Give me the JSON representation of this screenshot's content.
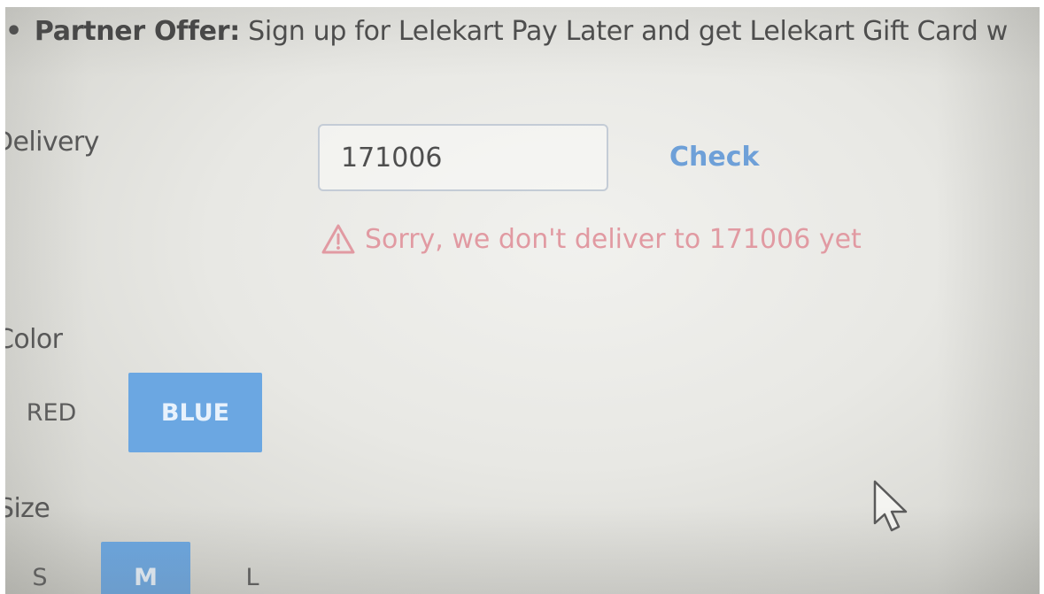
{
  "offer": {
    "bullet": "•",
    "prefix": "Partner Offer:",
    "text": " Sign up for Lelekart Pay Later and get Lelekart Gift Card w"
  },
  "delivery": {
    "label": "Delivery",
    "pincode_value": "171006",
    "check_label": "Check",
    "error_message": "Sorry, we don't deliver to 171006 yet",
    "error_color": "#e19aa2"
  },
  "color": {
    "label": "Color",
    "options": [
      "RED",
      "BLUE"
    ],
    "selected": "BLUE"
  },
  "size": {
    "label": "Size",
    "options": [
      "S",
      "M",
      "L"
    ],
    "selected": "M"
  },
  "theme": {
    "accent": "#6ba7e2",
    "link": "#6ea0d8"
  },
  "icons": {
    "error": "warning-triangle-icon",
    "pointer": "mouse-cursor-icon"
  }
}
